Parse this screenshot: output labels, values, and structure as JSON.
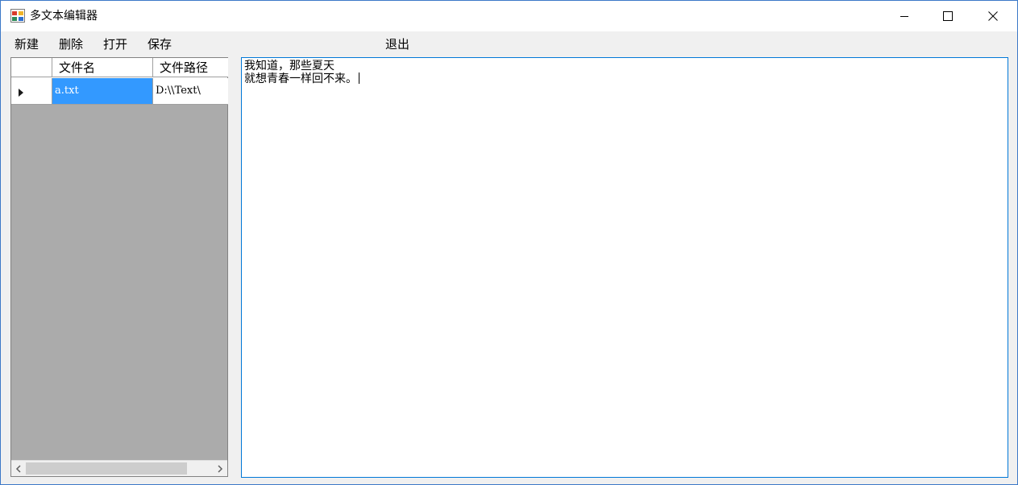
{
  "window": {
    "title": "多文本编辑器",
    "icon": "app-window-icon",
    "controls": {
      "minimize": "minimize-icon",
      "maximize": "maximize-icon",
      "close": "close-icon"
    }
  },
  "menu": {
    "new": "新建",
    "delete": "删除",
    "open": "打开",
    "save": "保存",
    "exit": "退出"
  },
  "grid": {
    "columns": [
      "文件名",
      "文件路径"
    ],
    "rows": [
      {
        "name": "a.txt",
        "path": "D:\\\\Text\\"
      }
    ],
    "selected_row": 0
  },
  "editor": {
    "lines": [
      "我知道，那些夏天",
      "就想青春一样回不来。"
    ]
  },
  "colors": {
    "selection": "#3399ff",
    "grid_background": "#ababab",
    "editor_border": "#0078d7",
    "window_border": "#3c78c8"
  }
}
